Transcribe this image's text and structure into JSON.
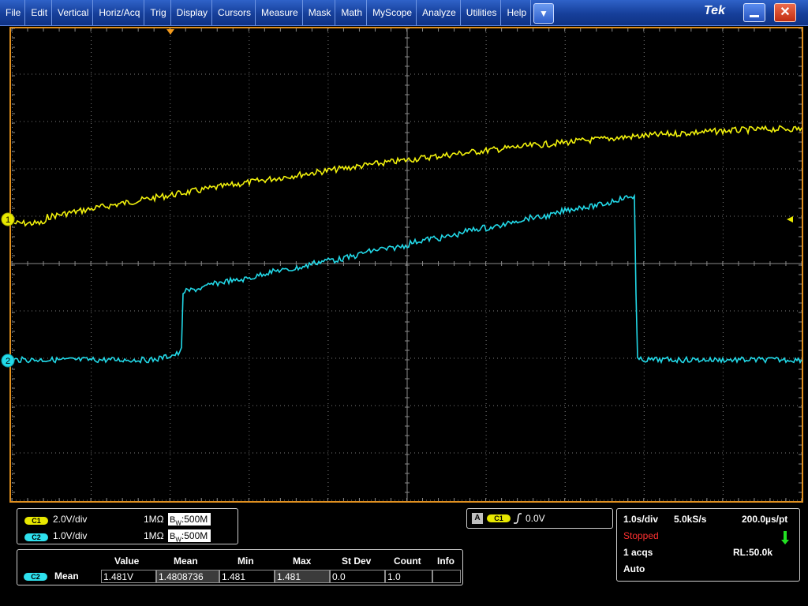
{
  "menu": {
    "items": [
      "File",
      "Edit",
      "Vertical",
      "Horiz/Acq",
      "Trig",
      "Display",
      "Cursors",
      "Measure",
      "Mask",
      "Math",
      "MyScope",
      "Analyze",
      "Utilities",
      "Help"
    ],
    "brand": "Tek"
  },
  "waveform": {
    "ch1_marker": "1",
    "ch2_marker": "2",
    "colors": {
      "ch1": "#f2f20c",
      "ch2": "#22d9e8",
      "grid": "#8a8a8a",
      "frame": "#e09020"
    }
  },
  "channels": {
    "ch1": {
      "badge": "C1",
      "scale": "2.0V/div",
      "impedance": "1MΩ",
      "bw_prefix": "B",
      "bw_sub": "W",
      "bw_value": ":500M"
    },
    "ch2": {
      "badge": "C2",
      "scale": "1.0V/div",
      "impedance": "1MΩ",
      "bw_prefix": "B",
      "bw_sub": "W",
      "bw_value": ":500M"
    }
  },
  "trigger": {
    "label": "A",
    "source": "C1",
    "level": "0.0V"
  },
  "measurement": {
    "headers": [
      "Value",
      "Mean",
      "Min",
      "Max",
      "St Dev",
      "Count",
      "Info"
    ],
    "source_badge": "C2",
    "name": "Mean",
    "row": [
      "1.481V",
      "1.4808736",
      "1.481",
      "1.481",
      "0.0",
      "1.0",
      ""
    ]
  },
  "acquisition": {
    "horiz_scale": "1.0s/div",
    "sample_rate": "5.0kS/s",
    "resolution": "200.0µs/pt",
    "state": "Stopped",
    "acqs": "1 acqs",
    "record_length": "RL:50.0k",
    "trigger_mode": "Auto"
  }
}
